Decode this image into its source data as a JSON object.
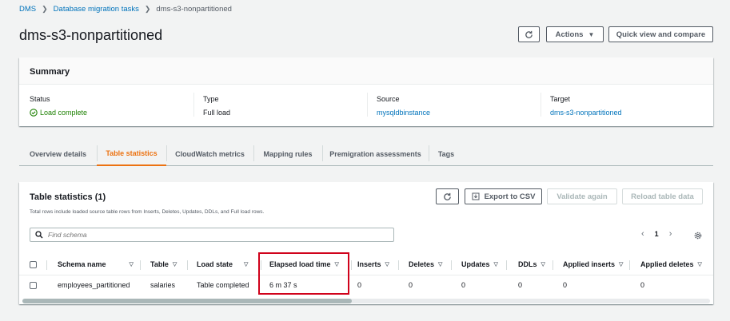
{
  "breadcrumb": {
    "root": "DMS",
    "parent": "Database migration tasks",
    "current": "dms-s3-nonpartitioned"
  },
  "page_title": "dms-s3-nonpartitioned",
  "header_buttons": {
    "actions": "Actions",
    "quick_view": "Quick view and compare"
  },
  "summary": {
    "title": "Summary",
    "status": {
      "label": "Status",
      "value": "Load complete"
    },
    "type": {
      "label": "Type",
      "value": "Full load"
    },
    "source": {
      "label": "Source",
      "value": "mysqldbinstance"
    },
    "target": {
      "label": "Target",
      "value": "dms-s3-nonpartitioned"
    }
  },
  "tabs": [
    "Overview details",
    "Table statistics",
    "CloudWatch metrics",
    "Mapping rules",
    "Premigration assessments",
    "Tags"
  ],
  "active_tab": "Table statistics",
  "table_stats": {
    "title": "Table statistics (1)",
    "description": "Total rows include loaded source table rows from Inserts, Deletes, Updates, DDLs, and Full load rows.",
    "buttons": {
      "export": "Export to CSV",
      "validate": "Validate again",
      "reload": "Reload table data"
    },
    "search_placeholder": "Find schema",
    "page": "1",
    "columns": [
      "Schema name",
      "Table",
      "Load state",
      "Elapsed load time",
      "Inserts",
      "Deletes",
      "Updates",
      "DDLs",
      "Applied inserts",
      "Applied deletes"
    ],
    "rows": [
      [
        "employees_partitioned",
        "salaries",
        "Table completed",
        "6 m 37 s",
        "0",
        "0",
        "0",
        "0",
        "0",
        "0"
      ]
    ]
  },
  "colors": {
    "link": "#0073bb",
    "success": "#1d8102",
    "accent": "#ec7211",
    "highlight": "#d0021b"
  }
}
